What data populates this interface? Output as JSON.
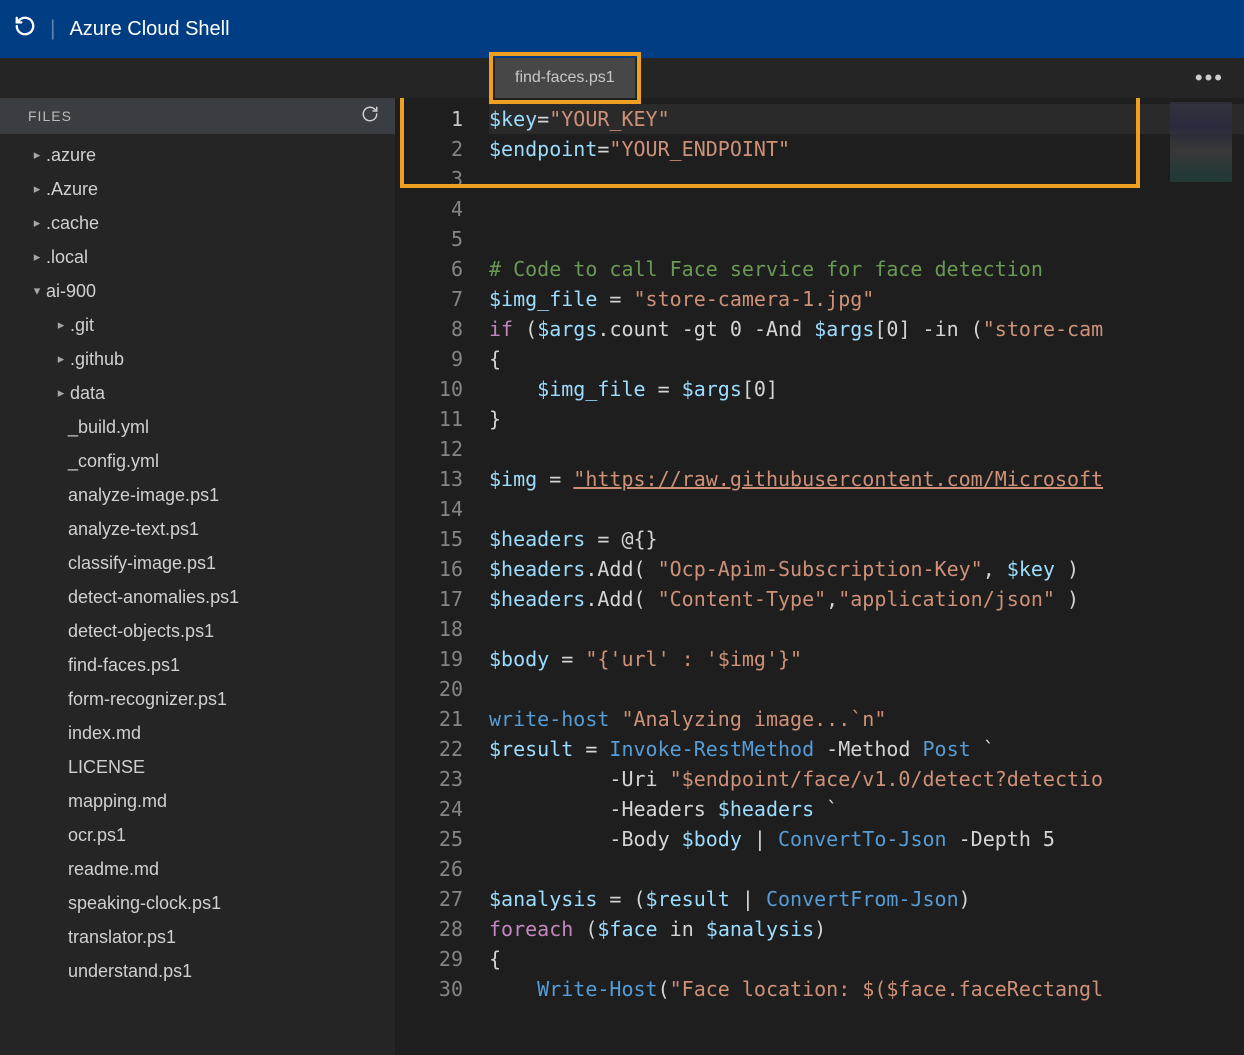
{
  "titlebar": {
    "title": "Azure Cloud Shell"
  },
  "tab": {
    "label": "find-faces.ps1"
  },
  "sidebar": {
    "header": "FILES",
    "items": [
      {
        "label": ".azure",
        "collapsed": true,
        "indent": 1
      },
      {
        "label": ".Azure",
        "collapsed": true,
        "indent": 1
      },
      {
        "label": ".cache",
        "collapsed": true,
        "indent": 1
      },
      {
        "label": ".local",
        "collapsed": true,
        "indent": 1
      },
      {
        "label": "ai-900",
        "collapsed": false,
        "indent": 1
      },
      {
        "label": ".git",
        "collapsed": true,
        "indent": 2
      },
      {
        "label": ".github",
        "collapsed": true,
        "indent": 2
      },
      {
        "label": "data",
        "collapsed": true,
        "indent": 2
      },
      {
        "label": "_build.yml",
        "indent": 3
      },
      {
        "label": "_config.yml",
        "indent": 3
      },
      {
        "label": "analyze-image.ps1",
        "indent": 3
      },
      {
        "label": "analyze-text.ps1",
        "indent": 3
      },
      {
        "label": "classify-image.ps1",
        "indent": 3
      },
      {
        "label": "detect-anomalies.ps1",
        "indent": 3
      },
      {
        "label": "detect-objects.ps1",
        "indent": 3
      },
      {
        "label": "find-faces.ps1",
        "indent": 3
      },
      {
        "label": "form-recognizer.ps1",
        "indent": 3
      },
      {
        "label": "index.md",
        "indent": 3
      },
      {
        "label": "LICENSE",
        "indent": 3
      },
      {
        "label": "mapping.md",
        "indent": 3
      },
      {
        "label": "ocr.ps1",
        "indent": 3
      },
      {
        "label": "readme.md",
        "indent": 3
      },
      {
        "label": "speaking-clock.ps1",
        "indent": 3
      },
      {
        "label": "translator.ps1",
        "indent": 3
      },
      {
        "label": "understand.ps1",
        "indent": 3
      }
    ]
  },
  "editor": {
    "lines": [
      {
        "n": 1,
        "t": [
          [
            "var",
            "$key"
          ],
          [
            "txt",
            "="
          ],
          [
            "str",
            "\"YOUR_KEY\""
          ]
        ]
      },
      {
        "n": 2,
        "t": [
          [
            "var",
            "$endpoint"
          ],
          [
            "txt",
            "="
          ],
          [
            "str",
            "\"YOUR_ENDPOINT\""
          ]
        ]
      },
      {
        "n": 3,
        "t": []
      },
      {
        "n": 4,
        "t": []
      },
      {
        "n": 5,
        "t": []
      },
      {
        "n": 6,
        "t": [
          [
            "cmt",
            "# Code to call Face service for face detection"
          ]
        ]
      },
      {
        "n": 7,
        "t": [
          [
            "var",
            "$img_file"
          ],
          [
            "txt",
            " = "
          ],
          [
            "str",
            "\"store-camera-1.jpg\""
          ]
        ]
      },
      {
        "n": 8,
        "t": [
          [
            "kw",
            "if"
          ],
          [
            "txt",
            " ("
          ],
          [
            "var",
            "$args"
          ],
          [
            "txt",
            ".count "
          ],
          [
            "txt",
            "-gt 0 -And "
          ],
          [
            "var",
            "$args"
          ],
          [
            "txt",
            "[0] -in ("
          ],
          [
            "str",
            "\"store-cam"
          ]
        ]
      },
      {
        "n": 9,
        "t": [
          [
            "txt",
            "{"
          ]
        ]
      },
      {
        "n": 10,
        "t": [
          [
            "txt",
            "    "
          ],
          [
            "var",
            "$img_file"
          ],
          [
            "txt",
            " = "
          ],
          [
            "var",
            "$args"
          ],
          [
            "txt",
            "[0]"
          ]
        ]
      },
      {
        "n": 11,
        "t": [
          [
            "txt",
            "}"
          ]
        ]
      },
      {
        "n": 12,
        "t": []
      },
      {
        "n": 13,
        "t": [
          [
            "var",
            "$img"
          ],
          [
            "txt",
            " = "
          ],
          [
            "link",
            "\"https://raw.githubusercontent.com/Microsoft"
          ]
        ]
      },
      {
        "n": 14,
        "t": []
      },
      {
        "n": 15,
        "t": [
          [
            "var",
            "$headers"
          ],
          [
            "txt",
            " = @{}"
          ]
        ]
      },
      {
        "n": 16,
        "t": [
          [
            "var",
            "$headers"
          ],
          [
            "txt",
            ".Add( "
          ],
          [
            "str",
            "\"Ocp-Apim-Subscription-Key\""
          ],
          [
            "txt",
            ", "
          ],
          [
            "var",
            "$key"
          ],
          [
            "txt",
            " )"
          ]
        ]
      },
      {
        "n": 17,
        "t": [
          [
            "var",
            "$headers"
          ],
          [
            "txt",
            ".Add( "
          ],
          [
            "str",
            "\"Content-Type\""
          ],
          [
            "txt",
            ","
          ],
          [
            "str",
            "\"application/json\""
          ],
          [
            "txt",
            " )"
          ]
        ]
      },
      {
        "n": 18,
        "t": []
      },
      {
        "n": 19,
        "t": [
          [
            "var",
            "$body"
          ],
          [
            "txt",
            " = "
          ],
          [
            "str",
            "\"{'url' : '$img'}\""
          ]
        ]
      },
      {
        "n": 20,
        "t": []
      },
      {
        "n": 21,
        "t": [
          [
            "cmd",
            "write-host"
          ],
          [
            "txt",
            " "
          ],
          [
            "str",
            "\"Analyzing image...`n\""
          ]
        ]
      },
      {
        "n": 22,
        "t": [
          [
            "var",
            "$result"
          ],
          [
            "txt",
            " = "
          ],
          [
            "cmd",
            "Invoke-RestMethod"
          ],
          [
            "txt",
            " -Method "
          ],
          [
            "cmd",
            "Post"
          ],
          [
            "txt",
            " `"
          ]
        ]
      },
      {
        "n": 23,
        "t": [
          [
            "txt",
            "          -Uri "
          ],
          [
            "str",
            "\"$endpoint/face/v1.0/detect?detectio"
          ]
        ]
      },
      {
        "n": 24,
        "t": [
          [
            "txt",
            "          -Headers "
          ],
          [
            "var",
            "$headers"
          ],
          [
            "txt",
            " `"
          ]
        ]
      },
      {
        "n": 25,
        "t": [
          [
            "txt",
            "          -Body "
          ],
          [
            "var",
            "$body"
          ],
          [
            "txt",
            " | "
          ],
          [
            "cmd",
            "ConvertTo-Json"
          ],
          [
            "txt",
            " -Depth 5"
          ]
        ]
      },
      {
        "n": 26,
        "t": []
      },
      {
        "n": 27,
        "t": [
          [
            "var",
            "$analysis"
          ],
          [
            "txt",
            " = ("
          ],
          [
            "var",
            "$result"
          ],
          [
            "txt",
            " | "
          ],
          [
            "cmd",
            "ConvertFrom-Json"
          ],
          [
            "txt",
            ")"
          ]
        ]
      },
      {
        "n": 28,
        "t": [
          [
            "kw",
            "foreach"
          ],
          [
            "txt",
            " ("
          ],
          [
            "var",
            "$face"
          ],
          [
            "txt",
            " in "
          ],
          [
            "var",
            "$analysis"
          ],
          [
            "txt",
            ")"
          ]
        ]
      },
      {
        "n": 29,
        "t": [
          [
            "txt",
            "{"
          ]
        ]
      },
      {
        "n": 30,
        "t": [
          [
            "txt",
            "    "
          ],
          [
            "cmd",
            "Write-Host"
          ],
          [
            "txt",
            "("
          ],
          [
            "str",
            "\"Face location: $($face.faceRectangl"
          ]
        ]
      }
    ]
  }
}
